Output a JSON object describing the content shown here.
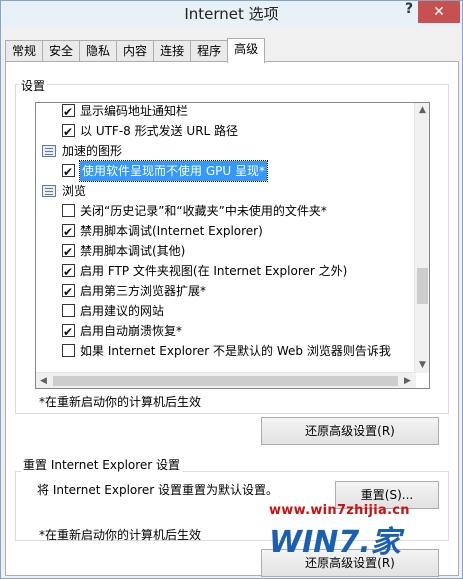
{
  "window": {
    "title": "Internet 选项",
    "help": "?",
    "close": "✕"
  },
  "tabs": [
    "常规",
    "安全",
    "隐私",
    "内容",
    "连接",
    "程序",
    "高级"
  ],
  "settings_group": {
    "label": "设置"
  },
  "list": [
    {
      "type": "check",
      "checked": true,
      "indent": 1,
      "label": "显示编码地址通知栏"
    },
    {
      "type": "check",
      "checked": true,
      "indent": 1,
      "label": "以 UTF-8 形式发送 URL 路径"
    },
    {
      "type": "category",
      "icon": "graphics-category-icon",
      "label": "加速的图形"
    },
    {
      "type": "check",
      "checked": true,
      "indent": 1,
      "selected": true,
      "label": "使用软件呈现而不使用 GPU 呈现*"
    },
    {
      "type": "category",
      "icon": "browsing-category-icon",
      "label": "浏览"
    },
    {
      "type": "check",
      "checked": false,
      "indent": 1,
      "label": "关闭“历史记录”和“收藏夹”中未使用的文件夹*"
    },
    {
      "type": "check",
      "checked": true,
      "indent": 1,
      "label": "禁用脚本调试(Internet Explorer)"
    },
    {
      "type": "check",
      "checked": true,
      "indent": 1,
      "label": "禁用脚本调试(其他)"
    },
    {
      "type": "check",
      "checked": true,
      "indent": 1,
      "label": "启用 FTP 文件夹视图(在 Internet Explorer 之外)"
    },
    {
      "type": "check",
      "checked": true,
      "indent": 1,
      "label": "启用第三方浏览器扩展*"
    },
    {
      "type": "check",
      "checked": false,
      "indent": 1,
      "label": "启用建议的网站"
    },
    {
      "type": "check",
      "checked": true,
      "indent": 1,
      "label": "启用自动崩溃恢复*"
    },
    {
      "type": "check",
      "checked": false,
      "indent": 1,
      "label": "如果 Internet Explorer 不是默认的 Web 浏览器则告诉我"
    }
  ],
  "restart_note_1": "*在重新启动你的计算机后生效",
  "restore_advanced_1": "还原高级设置(R)",
  "reset_section": {
    "title": "重置 Internet Explorer 设置",
    "description": "将 Internet Explorer 设置重置为默认设置。",
    "reset_button": "重置(S)..."
  },
  "restart_note_2": "*在重新启动你的计算机后生效",
  "restore_advanced_2": "还原高级设置(R)",
  "watermark": {
    "url": "www.win7zhijia.cn",
    "logo": "WIN7.家"
  },
  "colors": {
    "selection": "#3399ff",
    "close": "#c75050",
    "watermark_red": "#d01010",
    "watermark_blue": "#1a5fb4"
  }
}
